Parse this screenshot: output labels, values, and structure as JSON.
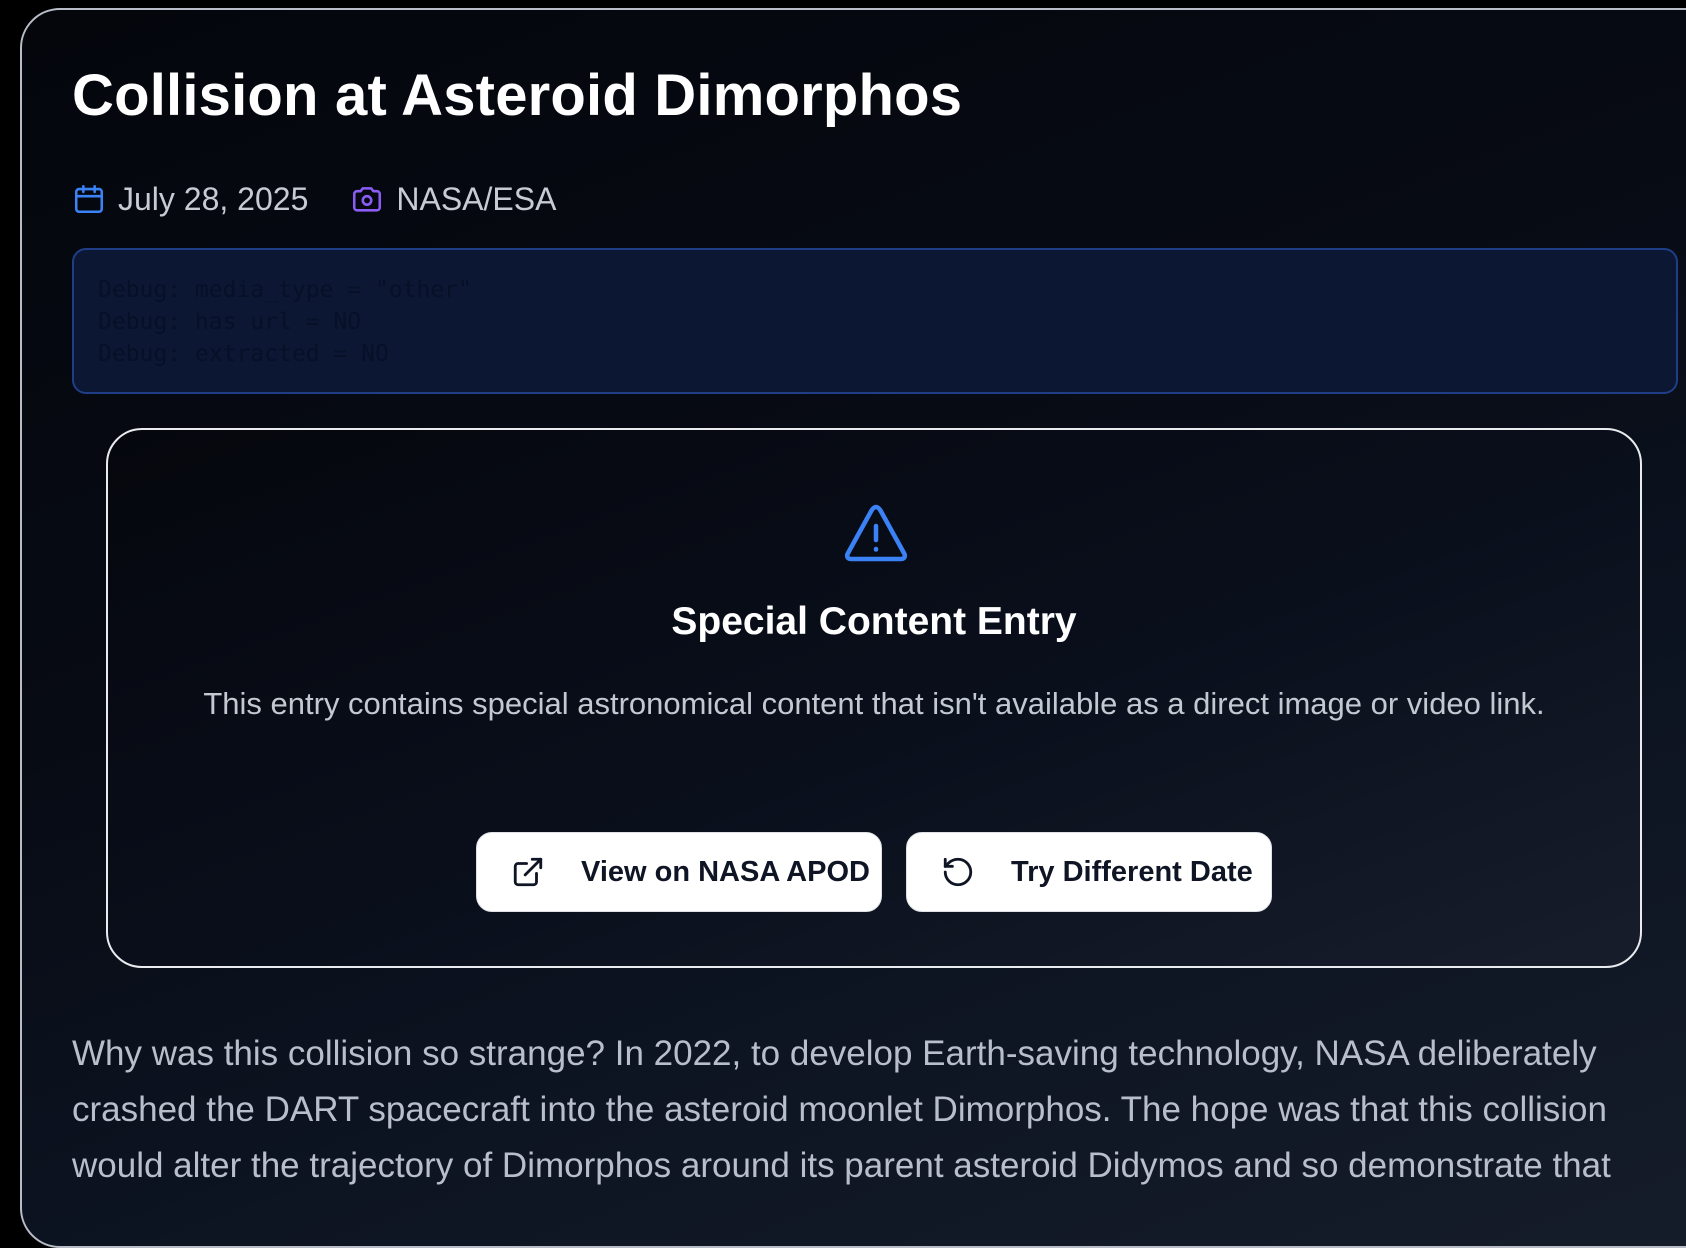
{
  "article": {
    "title": "Collision at Asteroid Dimorphos",
    "date": "July 28, 2025",
    "credit": "NASA/ESA"
  },
  "debug": {
    "lines": [
      "Debug: media_type = \"other\"",
      "Debug: has url = NO",
      "Debug: extracted = NO"
    ]
  },
  "special": {
    "heading": "Special Content Entry",
    "message": "This entry contains special astronomical content that isn't available as a direct image or video link.",
    "view_button": "View on NASA APOD",
    "retry_button": "Try Different Date"
  },
  "description": "Why was this collision so strange? In 2022, to develop Earth-saving technology, NASA deliberately crashed the DART spacecraft into the asteroid moonlet Dimorphos. The hope was that this collision would alter the trajectory of Dimorphos around its parent asteroid Didymos and so demonstrate that",
  "icons": {
    "date": "calendar-icon",
    "credit": "camera-icon",
    "warning": "warning-triangle-icon",
    "external": "external-link-icon",
    "retry": "rotate-ccw-icon"
  },
  "colors": {
    "calendar_icon": "#3b82f6",
    "camera_icon": "#8b5cf6",
    "warning_icon": "#3b82f6",
    "debug_border": "#1f3e86",
    "debug_background": "#0c1734"
  }
}
